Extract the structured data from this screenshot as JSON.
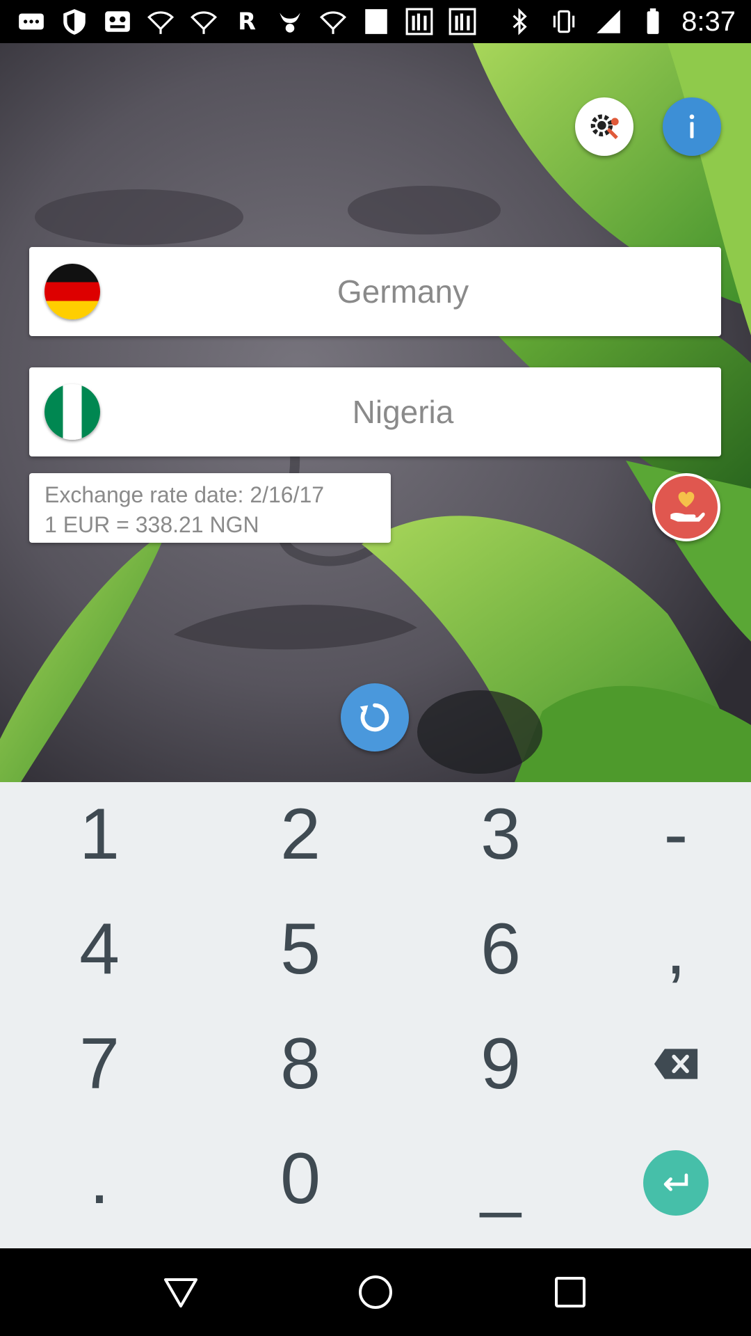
{
  "status_bar": {
    "time": "8:37",
    "icons": [
      "more-icon",
      "shield-icon",
      "game-icon",
      "wifi-icon",
      "wifi-icon",
      "r-app-icon",
      "horns-icon",
      "wifi-icon",
      "square-icon",
      "rfi-icon",
      "rfi-icon",
      "bluetooth-icon",
      "vibrate-icon",
      "signal-icon",
      "battery-icon"
    ]
  },
  "toolbar": {
    "settings_icon": "settings-wrench-icon",
    "info_icon": "info-icon"
  },
  "converter": {
    "from_country": "Germany",
    "to_country": "Nigeria",
    "rate_date_line": "Exchange rate date: 2/16/17",
    "rate_line": "1 EUR = 338.21 NGN"
  },
  "keypad": {
    "rows": [
      [
        "1",
        "2",
        "3",
        "-"
      ],
      [
        "4",
        "5",
        "6",
        ","
      ],
      [
        "7",
        "8",
        "9",
        "backspace-icon"
      ],
      [
        ".",
        "0",
        "_",
        "enter-icon"
      ]
    ]
  },
  "colors": {
    "accent_blue": "#3d8fd6",
    "donate_red": "#e0574f",
    "enter_green": "#46bfa9",
    "keypad_bg": "#eceff1"
  }
}
